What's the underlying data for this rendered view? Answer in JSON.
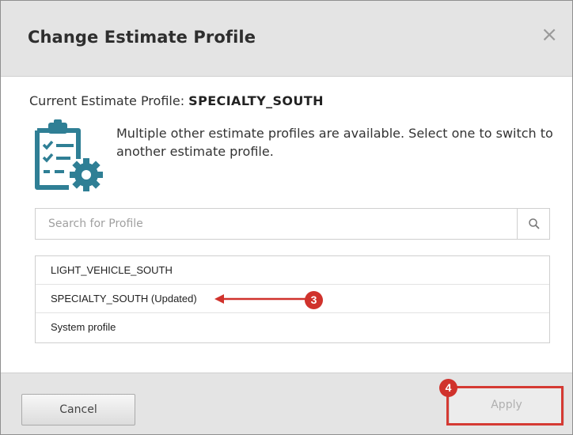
{
  "dialog": {
    "title": "Change Estimate Profile",
    "close_glyph": "×"
  },
  "current_profile": {
    "label": "Current Estimate Profile: ",
    "value": "SPECIALTY_SOUTH"
  },
  "description": "Multiple other estimate profiles are available. Select one to switch to another estimate profile.",
  "search": {
    "placeholder": "Search for Profile",
    "value": "",
    "icon": "search-icon"
  },
  "profiles": [
    {
      "label": "LIGHT_VEHICLE_SOUTH"
    },
    {
      "label": "SPECIALTY_SOUTH (Updated)"
    },
    {
      "label": "System profile"
    }
  ],
  "annotations": [
    {
      "label": "3"
    },
    {
      "label": "4"
    }
  ],
  "footer": {
    "cancel_label": "Cancel",
    "apply_label": "Apply"
  },
  "colors": {
    "accent_teal": "#2f7f95",
    "annotation_red": "#d0322c",
    "header_bg": "#e4e4e4"
  },
  "icons": {
    "profile_icon": "clipboard-gear-icon",
    "close_icon": "close-icon"
  }
}
